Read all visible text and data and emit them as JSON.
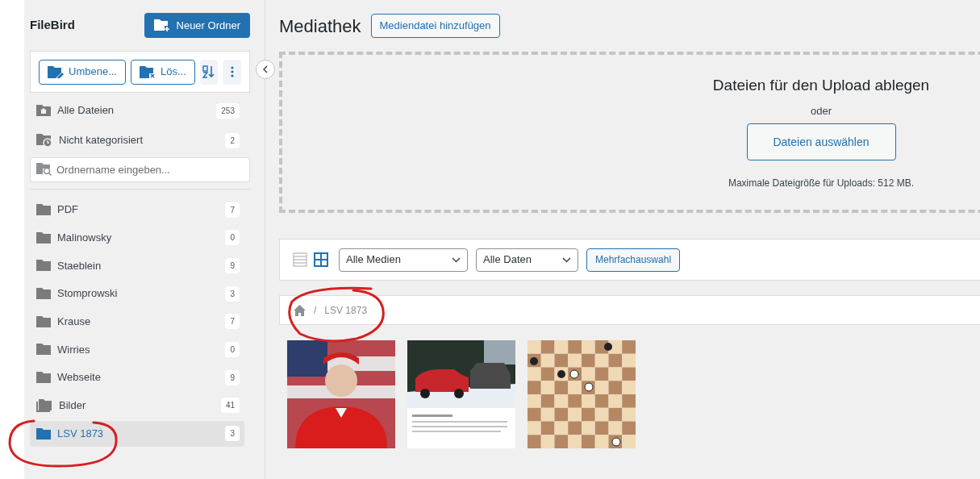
{
  "sidebar": {
    "title": "FileBird",
    "new_folder_button": "Neuer Ordner",
    "toolbar": [
      {
        "kind": "rename",
        "label": "Umbene..."
      },
      {
        "kind": "delete",
        "label": "Lös..."
      },
      {
        "kind": "sort"
      },
      {
        "kind": "more"
      }
    ],
    "special_items": [
      {
        "kind": "all",
        "label": "Alle Dateien",
        "count": "253",
        "selected": false
      },
      {
        "kind": "uncategorized",
        "label": "Nicht kategorisiert",
        "count": "2",
        "selected": false
      }
    ],
    "search": {
      "placeholder": "Ordnername eingeben..."
    },
    "folders": [
      {
        "kind": "folder",
        "label": "PDF",
        "count": "7",
        "selected": false
      },
      {
        "kind": "folder",
        "label": "Malinowsky",
        "count": "0",
        "selected": false
      },
      {
        "kind": "folder",
        "label": "Staeblein",
        "count": "9",
        "selected": false
      },
      {
        "kind": "folder",
        "label": "Stomprowski",
        "count": "3",
        "selected": false
      },
      {
        "kind": "folder",
        "label": "Krause",
        "count": "7",
        "selected": false
      },
      {
        "kind": "folder",
        "label": "Wirries",
        "count": "0",
        "selected": false
      },
      {
        "kind": "folder",
        "label": "Webseite",
        "count": "9",
        "selected": false
      },
      {
        "kind": "folder-stack",
        "label": "Bilder",
        "count": "41",
        "selected": false
      },
      {
        "kind": "folder",
        "label": "LSV 1873",
        "count": "3",
        "selected": true
      }
    ]
  },
  "main": {
    "title": "Mediathek",
    "add_button": "Mediendatei hinzufügen",
    "upload": {
      "heading": "Dateien für den Upload ablegen",
      "or": "oder",
      "button": "Dateien auswählen",
      "note": "Maximale Dateigröße für Uploads: 512 MB."
    },
    "toolbar": {
      "views": [
        {
          "kind": "list",
          "selected": false
        },
        {
          "kind": "grid",
          "selected": true
        }
      ],
      "filters": [
        "Alle Medien",
        "Alle Daten"
      ],
      "bulk_button": "Mehrfachauswahl"
    },
    "breadcrumb": {
      "separator": "/",
      "current": "LSV 1873"
    },
    "media": [
      {
        "kind": "portrait"
      },
      {
        "kind": "car"
      },
      {
        "kind": "board"
      }
    ]
  }
}
